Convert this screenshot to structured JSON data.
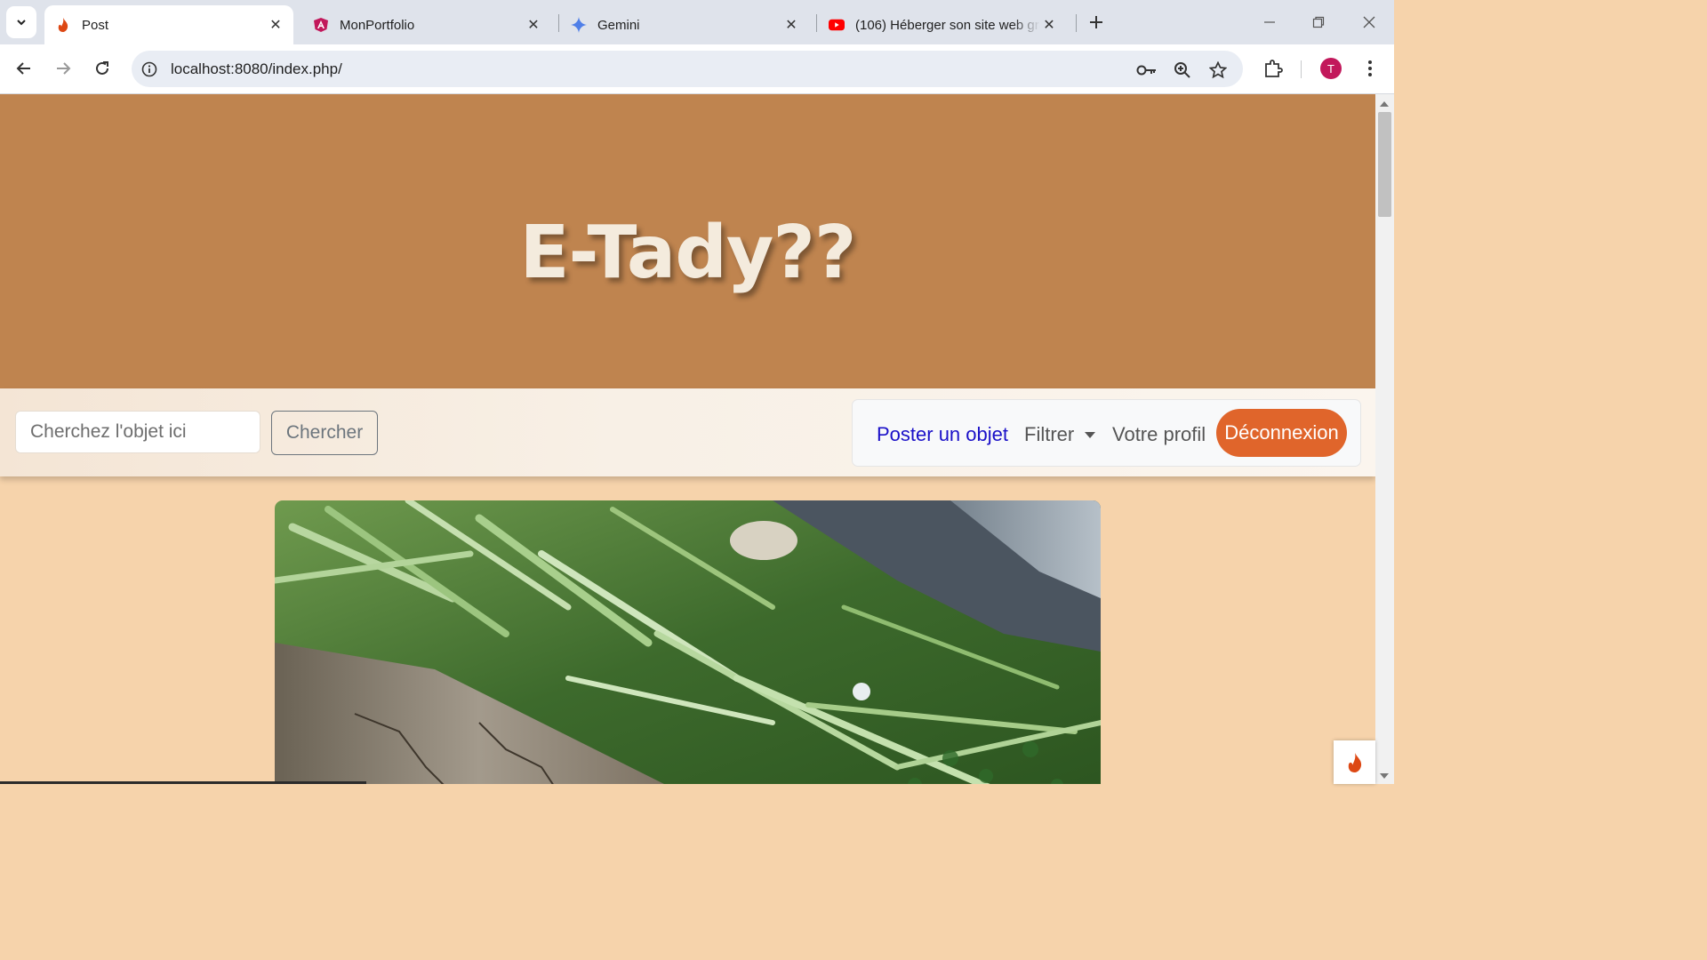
{
  "browser": {
    "tabs": [
      {
        "title": "Post",
        "active": true,
        "icon": "codeigniter-flame-icon"
      },
      {
        "title": "MonPortfolio",
        "active": false,
        "icon": "angular-icon"
      },
      {
        "title": "Gemini",
        "active": false,
        "icon": "gemini-sparkle-icon"
      },
      {
        "title": "(106) Héberger son site web gra",
        "active": false,
        "icon": "youtube-icon"
      }
    ],
    "url": "localhost:8080/index.php/",
    "profile_initial": "T"
  },
  "page": {
    "hero_title": "E-Tady??",
    "search": {
      "placeholder": "Cherchez l'objet ici",
      "button_label": "Chercher"
    },
    "nav": {
      "post_label": "Poster un objet",
      "filter_label": "Filtrer",
      "profile_label": "Votre profil",
      "logout_label": "Déconnexion"
    }
  },
  "colors": {
    "hero_bg": "#bf844f",
    "page_bg": "#f6d3ab",
    "logout_bg": "#e0652b",
    "link_blue": "#1a10c8"
  }
}
